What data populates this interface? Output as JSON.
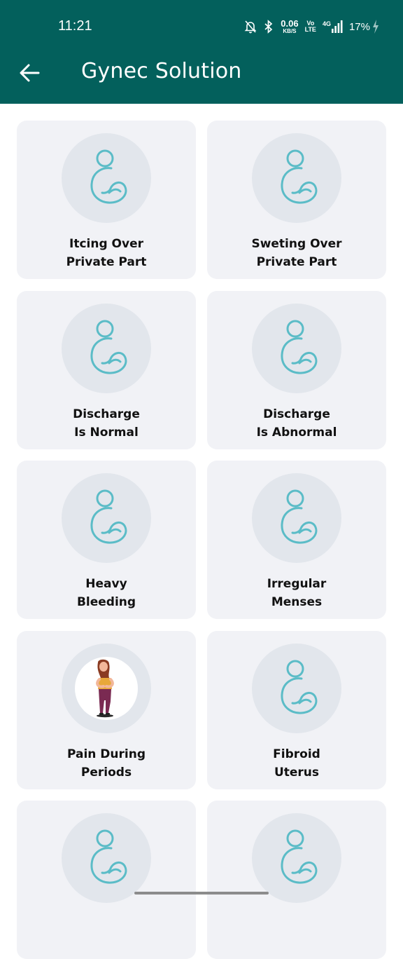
{
  "status_bar": {
    "time": "11:21",
    "net_speed_value": "0.06",
    "net_speed_unit": "KB/S",
    "volte_top": "Vo",
    "volte_bottom": "LTE",
    "network": "4G",
    "battery": "17%",
    "icons": [
      "bell-off-icon",
      "bluetooth-icon",
      "signal-icon",
      "charging-icon"
    ]
  },
  "header": {
    "title": "Gynec Solution",
    "back_icon": "arrow-left-icon"
  },
  "colors": {
    "header_bg": "#03605c",
    "card_bg": "#f1f2f6",
    "circle_bg": "#e2e6ec",
    "icon_stroke": "#5bbcc7"
  },
  "cards": [
    {
      "line1": "Itcing Over",
      "line2": "Private Part",
      "icon": "pregnancy-icon"
    },
    {
      "line1": "Sweting Over",
      "line2": "Private Part",
      "icon": "pregnancy-icon"
    },
    {
      "line1": "Discharge",
      "line2": "Is Normal",
      "icon": "pregnancy-icon"
    },
    {
      "line1": "Discharge",
      "line2": "Is Abnormal",
      "icon": "pregnancy-icon"
    },
    {
      "line1": "Heavy",
      "line2": "Bleeding",
      "icon": "pregnancy-icon"
    },
    {
      "line1": "Irregular",
      "line2": "Menses",
      "icon": "pregnancy-icon"
    },
    {
      "line1": "Pain During",
      "line2": "Periods",
      "icon": "woman-in-pain-illustration"
    },
    {
      "line1": "Fibroid",
      "line2": "Uterus",
      "icon": "pregnancy-icon"
    },
    {
      "line1": "",
      "line2": "",
      "icon": "pregnancy-icon"
    },
    {
      "line1": "",
      "line2": "",
      "icon": "pregnancy-icon"
    }
  ]
}
